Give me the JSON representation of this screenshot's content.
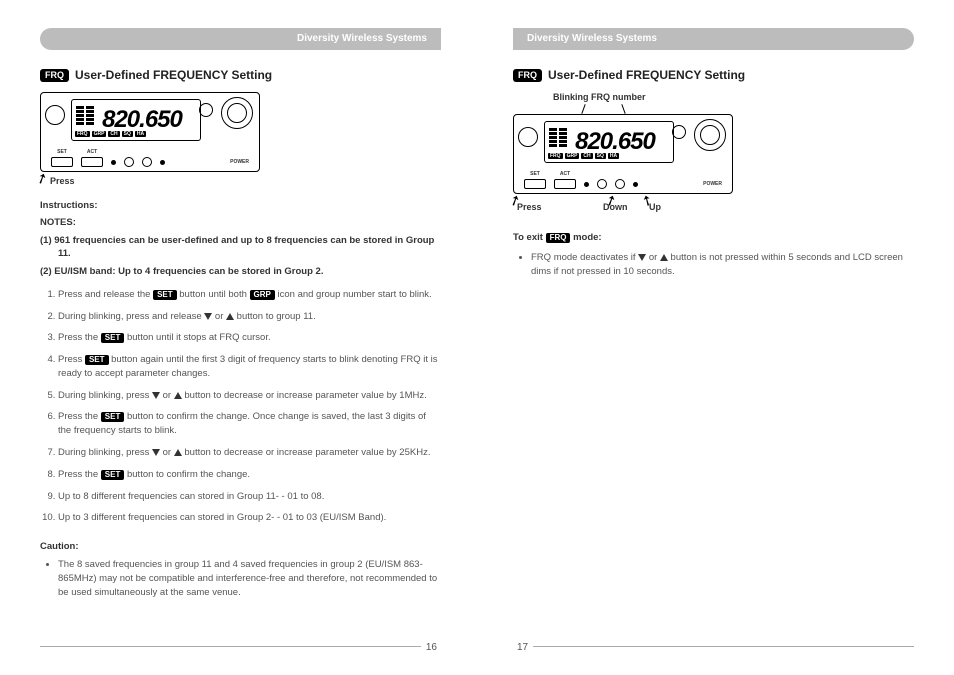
{
  "header": "Diversity Wireless Systems",
  "section_badge": "FRQ",
  "section_title": "User-Defined FREQUENCY Setting",
  "left": {
    "device": {
      "freq": "820.650",
      "btn_set": "SET",
      "btn_act": "ACT",
      "power": "POWER",
      "press_label": "Press"
    },
    "instructions_label": "Instructions:",
    "notes_label": "NOTES:",
    "note1_prefix": "(1)",
    "note1": "961 frequencies can be user-defined and up to 8 frequencies can be stored in Group 11.",
    "note2_prefix": "(2)",
    "note2": "EU/ISM band: Up to 4 frequencies can be stored in Group 2.",
    "set_badge": "SET",
    "grp_badge": "GRP",
    "steps": {
      "s1a": "Press and release the ",
      "s1b": " button until both ",
      "s1c": " icon and group number start to blink.",
      "s2a": "During blinking, press and release ",
      "s2b": " button to group 11.",
      "s3a": "Press the ",
      "s3b": " button until it stops at FRQ cursor.",
      "s4a": "Press ",
      "s4b": " button again until the first 3 digit of frequency starts to blink denoting FRQ it is ready to accept parameter changes.",
      "s5a": "During blinking, press ",
      "s5b": " button to decrease or increase parameter value by 1MHz.",
      "s6a": "Press the ",
      "s6b": " button to confirm the change. Once change is saved, the last 3 digits of the frequency starts to blink.",
      "s7a": "During blinking, press ",
      "s7b": " button to decrease or increase parameter value by 25KHz.",
      "s8a": "Press the ",
      "s8b": " button to confirm the change.",
      "s9": "Up to 8 different frequencies can stored in Group 11- - 01 to 08.",
      "s10": "Up to 3 different frequencies can stored in Group 2- - 01 to 03 (EU/ISM Band)."
    },
    "or": " or ",
    "caution_label": "Caution:",
    "caution_text": "The 8 saved frequencies in group 11 and 4 saved frequencies in group 2 (EU/ISM 863-865MHz) may not be compatible and interference-free and therefore, not recommended to be used simultaneously at the same venue.",
    "page_num": "16"
  },
  "right": {
    "blinking_label": "Blinking FRQ number",
    "device": {
      "freq": "820.650",
      "btn_set": "SET",
      "btn_act": "ACT",
      "power": "POWER"
    },
    "press_label": "Press",
    "down_label": "Down",
    "up_label": "Up",
    "exit_a": "To exit ",
    "exit_b": " mode:",
    "frq_badge": "FRQ",
    "exit_bullet_a": "FRQ mode deactivates if ",
    "exit_bullet_b": " button is not pressed within 5 seconds and LCD screen dims if not pressed in 10 seconds.",
    "or": " or ",
    "page_num": "17"
  }
}
